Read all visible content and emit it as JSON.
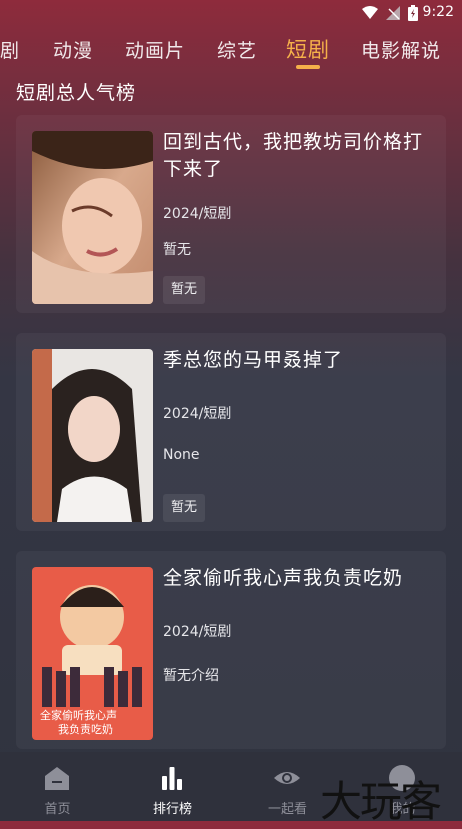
{
  "status": {
    "time": "9:22"
  },
  "tabs": [
    {
      "label": "剧"
    },
    {
      "label": "动漫"
    },
    {
      "label": "动画片"
    },
    {
      "label": "综艺"
    },
    {
      "label": "短剧",
      "active": true
    },
    {
      "label": "电影解说"
    }
  ],
  "section": {
    "title": "短剧总人气榜"
  },
  "cards": [
    {
      "title": "回到古代，我把教坊司价格打下来了",
      "meta": "2024/短剧",
      "desc": "暂无",
      "tag": "暂无"
    },
    {
      "title": "季总您的马甲叒掉了",
      "meta": "2024/短剧",
      "desc": "None",
      "tag": "暂无"
    },
    {
      "title": "全家偷听我心声我负责吃奶",
      "meta": "2024/短剧",
      "desc": "暂无介绍",
      "poster_text": [
        "全家偷听我心声",
        "我负责吃奶"
      ]
    }
  ],
  "nav": [
    {
      "label": "首页",
      "icon": "home-icon"
    },
    {
      "label": "排行榜",
      "icon": "bar-chart-icon",
      "active": true
    },
    {
      "label": "一起看",
      "icon": "eye-icon"
    },
    {
      "label": "我的",
      "icon": "user-icon"
    }
  ],
  "watermark": {
    "text": "大玩客"
  },
  "colors": {
    "accent": "#f5b04a",
    "nav_active": "#ffffff",
    "nav_inactive": "#8e8f99"
  }
}
